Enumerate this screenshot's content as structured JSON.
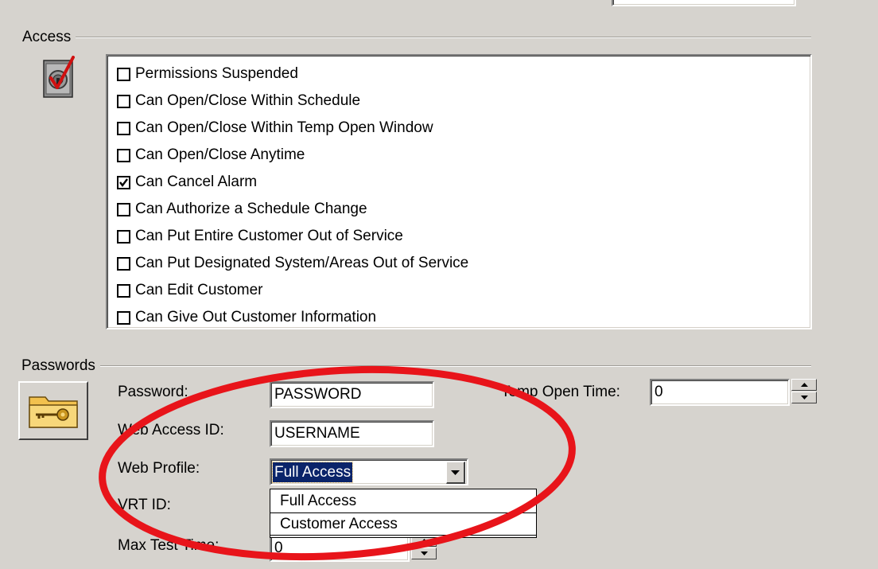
{
  "access": {
    "title": "Access",
    "icon": "lock-check-icon",
    "permissions": [
      {
        "label": "Permissions Suspended",
        "checked": false
      },
      {
        "label": "Can Open/Close Within Schedule",
        "checked": false
      },
      {
        "label": "Can Open/Close Within Temp Open Window",
        "checked": false
      },
      {
        "label": "Can Open/Close Anytime",
        "checked": false
      },
      {
        "label": "Can Cancel Alarm",
        "checked": true
      },
      {
        "label": "Can Authorize a Schedule Change",
        "checked": false
      },
      {
        "label": "Can Put Entire Customer Out of Service",
        "checked": false
      },
      {
        "label": "Can Put Designated System/Areas Out of Service",
        "checked": false
      },
      {
        "label": "Can Edit Customer",
        "checked": false
      },
      {
        "label": "Can Give Out Customer Information",
        "checked": false
      }
    ]
  },
  "passwords": {
    "title": "Passwords",
    "icon": "key-folder-icon",
    "password_label": "Password:",
    "password_value": "PASSWORD",
    "web_access_id_label": "Web Access ID:",
    "web_access_id_value": "USERNAME",
    "web_profile_label": "Web Profile:",
    "web_profile_value": "Full Access",
    "web_profile_options": [
      "Full Access",
      "Customer Access"
    ],
    "vrt_id_label": "VRT ID:",
    "max_test_time_label": "Max Test Time:",
    "max_test_time_value": "0",
    "temp_open_time_label": "Temp Open Time:",
    "temp_open_time_value": "0"
  },
  "colors": {
    "window_bg": "#d6d3ce",
    "highlight": "#0a246a",
    "annotation_ellipse": "#e8141a"
  }
}
